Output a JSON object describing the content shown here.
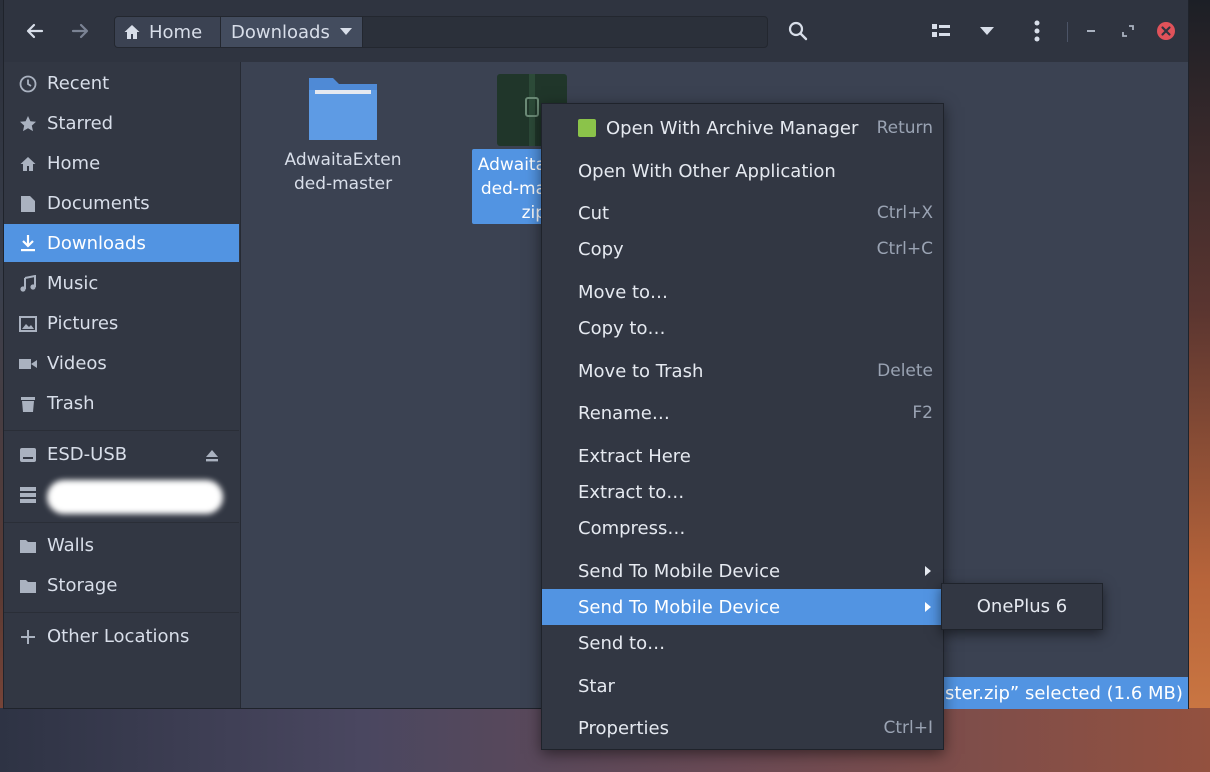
{
  "window": {
    "breadcrumb": [
      "Home",
      "Downloads"
    ],
    "sidebar": {
      "places": [
        "Recent",
        "Starred",
        "Home",
        "Documents",
        "Downloads",
        "Music",
        "Pictures",
        "Videos",
        "Trash"
      ],
      "devices": [
        "ESD-USB"
      ],
      "bookmarks": [
        "Walls",
        "Storage"
      ],
      "other": "Other Locations",
      "active": "Downloads"
    },
    "files": [
      {
        "name_line1": "AdwaitaExten",
        "name_line2": "ded-master",
        "name_line3": "",
        "kind": "folder"
      },
      {
        "name_line1": "Adwaita",
        "name_line2": "ded-ma",
        "name_line3": "zip",
        "kind": "archive"
      }
    ],
    "status": "ster.zip” selected  (1.6 MB)"
  },
  "context_menu": {
    "items": [
      {
        "label": "Open With Archive Manager",
        "accel": "Return"
      },
      {
        "label": "Open With Other Application",
        "accel": ""
      },
      {
        "label": "Cut",
        "accel": "Ctrl+X"
      },
      {
        "label": "Copy",
        "accel": "Ctrl+C"
      },
      {
        "label": "Move to…",
        "accel": ""
      },
      {
        "label": "Copy to…",
        "accel": ""
      },
      {
        "label": "Move to Trash",
        "accel": "Delete"
      },
      {
        "label": "Rename…",
        "accel": "F2"
      },
      {
        "label": "Extract Here",
        "accel": ""
      },
      {
        "label": "Extract to…",
        "accel": ""
      },
      {
        "label": "Compress…",
        "accel": ""
      },
      {
        "label": "Send To Mobile Device",
        "accel": ""
      },
      {
        "label": "Send To Mobile Device",
        "accel": ""
      },
      {
        "label": "Send to…",
        "accel": ""
      },
      {
        "label": "Star",
        "accel": ""
      },
      {
        "label": "Properties",
        "accel": "Ctrl+I"
      }
    ],
    "submenu": {
      "label": "OnePlus 6"
    }
  },
  "colors": {
    "accent": "#5294e2",
    "window_bg": "#3b4252",
    "sidebar_bg": "#323743",
    "close_button": "#e0525a"
  }
}
